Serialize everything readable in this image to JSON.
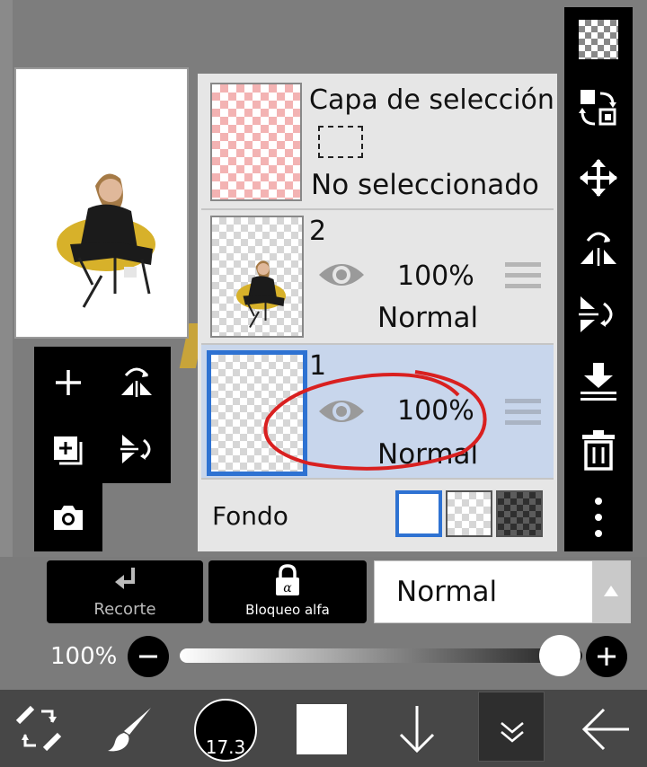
{
  "layers_panel": {
    "selection_layer": {
      "title": "Capa de selección",
      "status": "No seleccionado"
    },
    "layers": [
      {
        "number": "2",
        "opacity": "100%",
        "blend": "Normal"
      },
      {
        "number": "1",
        "opacity": "100%",
        "blend": "Normal"
      }
    ],
    "background": {
      "label": "Fondo"
    }
  },
  "layer_controls": {
    "clip_label": "Recorte",
    "alpha_lock_label": "Bloqueo alfa",
    "blend_mode_value": "Normal"
  },
  "opacity_row": {
    "value": "100%",
    "level": 0.85
  },
  "bottom_toolbar": {
    "brush_size": "17.3"
  },
  "colors": {
    "selected_layer_bg": "#c8d6ec",
    "accent_blue": "#2e72d2",
    "annotation_red": "#d92020"
  }
}
